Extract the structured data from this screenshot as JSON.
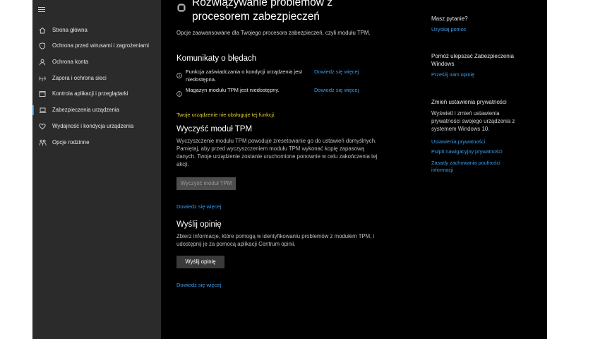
{
  "sidebar": {
    "items": [
      {
        "label": "Strona główna",
        "icon": "home-icon"
      },
      {
        "label": "Ochrona przed wirusami i zagrożeniami",
        "icon": "shield-icon"
      },
      {
        "label": "Ochrona konta",
        "icon": "person-icon"
      },
      {
        "label": "Zapora i ochrona sieci",
        "icon": "wifi-icon"
      },
      {
        "label": "Kontrola aplikacji i przeglądarki",
        "icon": "browser-icon"
      },
      {
        "label": "Zabezpieczenia urządzenia",
        "icon": "laptop-icon",
        "selected": true
      },
      {
        "label": "Wydajność i kondycja urządzenia",
        "icon": "heart-icon"
      },
      {
        "label": "Opcje rodzinne",
        "icon": "family-icon"
      }
    ]
  },
  "main": {
    "title": "Rozwiązywanie problemów z procesorem zabezpieczeń",
    "description": "Opcje zaawansowane dla Twojego procesora zabezpieczeń, czyli modułu TPM.",
    "errors_heading": "Komunikaty o błędach",
    "errors": [
      {
        "text": "Funkcja zaświadczania o kondycji urządzenia jest niedostępna.",
        "link": "Dowiedz się więcej"
      },
      {
        "text": "Magazyn modułu TPM jest niedostępny.",
        "link": "Dowiedz się więcej"
      }
    ],
    "warning": "Twoje urządzenie nie obsługuje tej funkcji.",
    "clear_heading": "Wyczyść moduł TPM",
    "clear_text": "Wyczyszczenie modułu TPM powoduje zresetowanie go do ustawień domyślnych. Pamiętaj, aby przed wyczyszczeniem modułu TPM wykonać kopię zapasową danych. Twoje urządzenie zostanie uruchomione ponownie w celu zakończenia tej akcji.",
    "clear_button": "Wyczyść moduł TPM",
    "clear_link": "Dowiedz się więcej",
    "feedback_heading": "Wyślij opinię",
    "feedback_text": "Zbierz informacje, które pomogą w identyfikowaniu problemów z modułem TPM, i udostępnij je za pomocą aplikacji Centrum opinii.",
    "feedback_button": "Wyślij opinię",
    "feedback_link": "Dowiedz się więcej"
  },
  "right": {
    "question_heading": "Masz pytanie?",
    "help_link": "Uzyskaj pomoc",
    "improve_heading": "Pomóż ulepszać Zabezpieczenia Windows",
    "feedback_link": "Prześlij nam opinię",
    "privacy_heading": "Zmień ustawienia prywatności",
    "privacy_text": "Wyświetl i zmień ustawienia prywatności swojego urządzenia z systemem Windows 10.",
    "privacy_links": [
      "Ustawienia prywatności",
      "Pulpit nawigacyjny prywatności",
      "Zasady zachowania poufności informacji"
    ]
  },
  "colors": {
    "accent": "#2b8fe0",
    "link": "#3e9be6",
    "warning": "#e3d23b",
    "sidebar_bg": "#2b2b2b",
    "content_bg": "#000000"
  }
}
